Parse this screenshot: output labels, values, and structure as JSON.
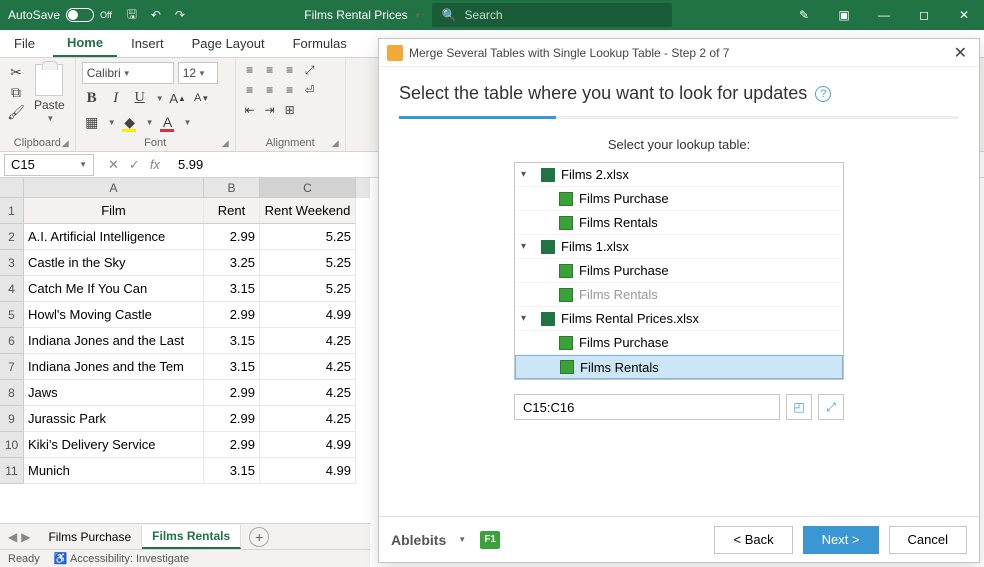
{
  "titlebar": {
    "autosave": "AutoSave",
    "autosave_state": "Off",
    "doc_title": "Films Rental Prices",
    "search_placeholder": "Search"
  },
  "tabs": {
    "file": "File",
    "home": "Home",
    "insert": "Insert",
    "page_layout": "Page Layout",
    "formulas": "Formulas"
  },
  "ribbon": {
    "clipboard": {
      "paste": "Paste",
      "label": "Clipboard"
    },
    "font": {
      "name": "Calibri",
      "size": "12",
      "label": "Font"
    },
    "alignment": {
      "label": "Alignment"
    }
  },
  "formula_bar": {
    "name_box": "C15",
    "fx_label": "fx",
    "value": "5.99"
  },
  "grid": {
    "cols": [
      "A",
      "B",
      "C"
    ],
    "headers": [
      "Film",
      "Rent",
      "Rent Weekend"
    ],
    "rows": [
      {
        "n": "2",
        "a": "A.I. Artificial Intelligence",
        "b": "2.99",
        "c": "5.25"
      },
      {
        "n": "3",
        "a": "Castle in the Sky",
        "b": "3.25",
        "c": "5.25"
      },
      {
        "n": "4",
        "a": "Catch Me If You Can",
        "b": "3.15",
        "c": "5.25"
      },
      {
        "n": "5",
        "a": "Howl's Moving Castle",
        "b": "2.99",
        "c": "4.99"
      },
      {
        "n": "6",
        "a": "Indiana Jones and the Last",
        "b": "3.15",
        "c": "4.25"
      },
      {
        "n": "7",
        "a": "Indiana Jones and the Tem",
        "b": "3.15",
        "c": "4.25"
      },
      {
        "n": "8",
        "a": "Jaws",
        "b": "2.99",
        "c": "4.25"
      },
      {
        "n": "9",
        "a": "Jurassic Park",
        "b": "2.99",
        "c": "4.25"
      },
      {
        "n": "10",
        "a": "Kiki's Delivery Service",
        "b": "2.99",
        "c": "4.99"
      },
      {
        "n": "11",
        "a": "Munich",
        "b": "3.15",
        "c": "4.99"
      }
    ]
  },
  "sheets": {
    "s1": "Films Purchase",
    "s2": "Films Rentals"
  },
  "status": {
    "ready": "Ready",
    "acc": "Accessibility: Investigate"
  },
  "dialog": {
    "title": "Merge Several Tables with Single Lookup Table - Step 2 of 7",
    "heading": "Select the table where you want to look for updates",
    "sub": "Select your lookup table:",
    "tree": [
      {
        "t": "wb",
        "label": "Films 2.xlsx"
      },
      {
        "t": "sh",
        "label": "Films Purchase"
      },
      {
        "t": "sh",
        "label": "Films Rentals"
      },
      {
        "t": "wb",
        "label": "Films 1.xlsx"
      },
      {
        "t": "sh",
        "label": "Films Purchase"
      },
      {
        "t": "sh",
        "label": "Films Rentals",
        "dim": true
      },
      {
        "t": "wb",
        "label": "Films Rental Prices.xlsx"
      },
      {
        "t": "sh",
        "label": "Films Purchase"
      },
      {
        "t": "sh",
        "label": "Films Rentals",
        "sel": true
      }
    ],
    "range": "C15:C16",
    "brand": "Ablebits",
    "back": "< Back",
    "next": "Next >",
    "cancel": "Cancel"
  }
}
